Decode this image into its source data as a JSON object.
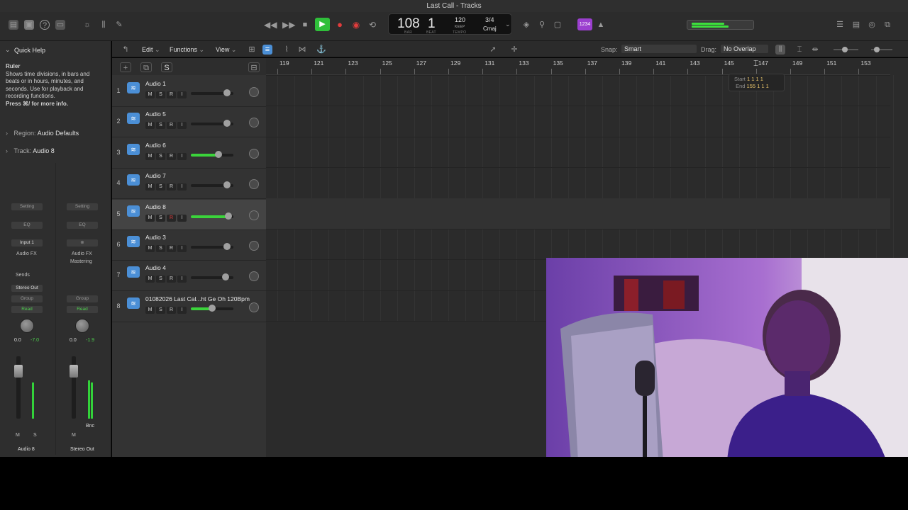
{
  "window": {
    "title": "Last Call - Tracks"
  },
  "lcd": {
    "bar": "108",
    "beat": "1",
    "bar_label": "BAR",
    "beat_label": "BEAT",
    "tempo": "120",
    "tempo_mode": "KEEP",
    "tempo_label": "TEMPO",
    "signature": "3/4",
    "key": "Cmaj"
  },
  "toolbar": {
    "lcd_mode_badge": "1234"
  },
  "inspector": {
    "quick_help": "Quick Help",
    "help_title": "Ruler",
    "help_body": "Shows time divisions, in bars and beats or in hours, minutes, and seconds. Use for playback and recording functions.",
    "help_more": "Press ⌘/ for more info.",
    "region_label": "Region:",
    "region_value": "Audio Defaults",
    "track_label": "Track:",
    "track_value": "Audio 8"
  },
  "strip1": {
    "setting": "Setting",
    "eq": "EQ",
    "input": "Input 1",
    "audio_fx": "Audio FX",
    "sends": "Sends",
    "output": "Stereo Out",
    "group": "Group",
    "read": "Read",
    "vol": "0.0",
    "peak": "-7.0",
    "m": "M",
    "s": "S",
    "name": "Audio 8"
  },
  "strip2": {
    "setting": "Setting",
    "eq": "EQ",
    "audio_fx": "Audio FX",
    "fx1": "Mastering",
    "group": "Group",
    "read": "Read",
    "vol": "0.0",
    "peak": "-1.9",
    "bnc": "Bnc",
    "m": "M",
    "name": "Stereo Out"
  },
  "menus": {
    "edit": "Edit",
    "functions": "Functions",
    "view": "View"
  },
  "snap": {
    "label": "Snap:",
    "value": "Smart"
  },
  "drag": {
    "label": "Drag:",
    "value": "No Overlap"
  },
  "track_header_btns": {
    "s": "S"
  },
  "ruler": [
    "119",
    "121",
    "123",
    "125",
    "127",
    "129",
    "131",
    "133",
    "135",
    "137",
    "139",
    "141",
    "143",
    "145",
    "147",
    "149",
    "151",
    "153"
  ],
  "tooltip": {
    "start_label": "Start",
    "start_value": "1 1 1 1",
    "end_label": "End",
    "end_value": "155 1 1 1"
  },
  "tracks": [
    {
      "num": "1",
      "name": "Audio 1",
      "m": "M",
      "s": "S",
      "r": "R",
      "i": "I",
      "volume": 0.85
    },
    {
      "num": "2",
      "name": "Audio 5",
      "m": "M",
      "s": "S",
      "r": "R",
      "i": "I",
      "volume": 0.85
    },
    {
      "num": "3",
      "name": "Audio 6",
      "m": "M",
      "s": "S",
      "r": "R",
      "i": "I",
      "volume": 0.65
    },
    {
      "num": "4",
      "name": "Audio 7",
      "m": "M",
      "s": "S",
      "r": "R",
      "i": "I",
      "volume": 0.85
    },
    {
      "num": "5",
      "name": "Audio 8",
      "m": "M",
      "s": "S",
      "r": "R",
      "i": "I",
      "volume": 0.88
    },
    {
      "num": "6",
      "name": "Audio 3",
      "m": "M",
      "s": "S",
      "r": "R",
      "i": "I",
      "volume": 0.85
    },
    {
      "num": "7",
      "name": "Audio 4",
      "m": "M",
      "s": "S",
      "r": "R",
      "i": "I",
      "volume": 0.82
    },
    {
      "num": "8",
      "name": "01082026 Last Cal...ht  Ge Oh  120Bpm",
      "m": "M",
      "s": "S",
      "r": "R",
      "i": "I",
      "volume": 0.5
    }
  ],
  "colors": {
    "accent": "#4b8fd6",
    "play": "#2fbf3a",
    "record": "#e23c3c",
    "level": "#33d23a"
  }
}
